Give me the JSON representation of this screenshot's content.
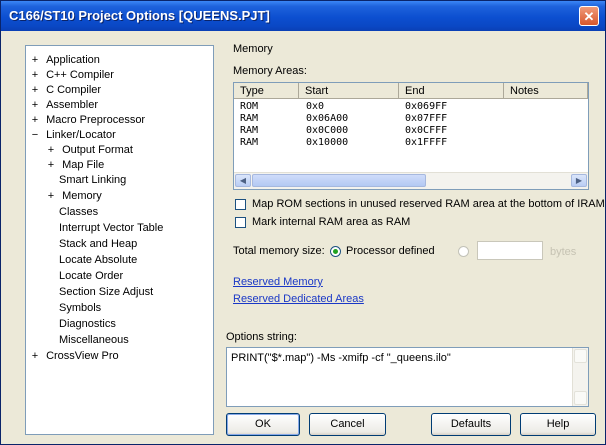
{
  "window": {
    "title": "C166/ST10 Project Options [QUEENS.PJT]",
    "close_glyph": "✕"
  },
  "tree": {
    "items": [
      {
        "label": "Application",
        "expander": "+"
      },
      {
        "label": "C++ Compiler",
        "expander": "+"
      },
      {
        "label": "C Compiler",
        "expander": "+"
      },
      {
        "label": "Assembler",
        "expander": "+"
      },
      {
        "label": "Macro Preprocessor",
        "expander": "+"
      },
      {
        "label": "Linker/Locator",
        "expander": "−"
      },
      {
        "label": "Output Format",
        "expander": "+"
      },
      {
        "label": "Map File",
        "expander": "+"
      },
      {
        "label": "Smart Linking",
        "expander": ""
      },
      {
        "label": "Memory",
        "expander": "+"
      },
      {
        "label": "Classes",
        "expander": ""
      },
      {
        "label": "Interrupt Vector Table",
        "expander": ""
      },
      {
        "label": "Stack and Heap",
        "expander": ""
      },
      {
        "label": "Locate Absolute",
        "expander": ""
      },
      {
        "label": "Locate Order",
        "expander": ""
      },
      {
        "label": "Section Size Adjust",
        "expander": ""
      },
      {
        "label": "Symbols",
        "expander": ""
      },
      {
        "label": "Diagnostics",
        "expander": ""
      },
      {
        "label": "Miscellaneous",
        "expander": ""
      },
      {
        "label": "CrossView Pro",
        "expander": "+"
      }
    ]
  },
  "memory": {
    "group_label": "Memory",
    "areas_label": "Memory Areas:",
    "columns": [
      "Type",
      "Start",
      "End",
      "Notes"
    ],
    "rows": [
      [
        "ROM",
        "0x0",
        "0x069FF",
        ""
      ],
      [
        "RAM",
        "0x06A00",
        "0x07FFF",
        ""
      ],
      [
        "RAM",
        "0x0C000",
        "0x0CFFF",
        ""
      ],
      [
        "RAM",
        "0x10000",
        "0x1FFFF",
        ""
      ]
    ],
    "scroll_left": "◀",
    "scroll_right": "▶",
    "map_rom_label": "Map ROM sections in unused reserved RAM area at the bottom of IRAM",
    "mark_internal_label": "Mark internal RAM area as RAM",
    "total_label": "Total memory size:",
    "processor_defined_label": "Processor defined",
    "bytes_label": "bytes",
    "reserved_memory_link": "Reserved Memory",
    "reserved_dedicated_link": "Reserved Dedicated Areas"
  },
  "options": {
    "label": "Options string:",
    "value": "PRINT(\"$*.map\") -Ms -xmifp -cf \"_queens.ilo\""
  },
  "buttons": {
    "ok": "OK",
    "cancel": "Cancel",
    "defaults": "Defaults",
    "help": "Help"
  },
  "colors": {
    "title_bar": "#0a47c4",
    "link": "#1a38c6",
    "window_bg": "#ece9d8"
  }
}
